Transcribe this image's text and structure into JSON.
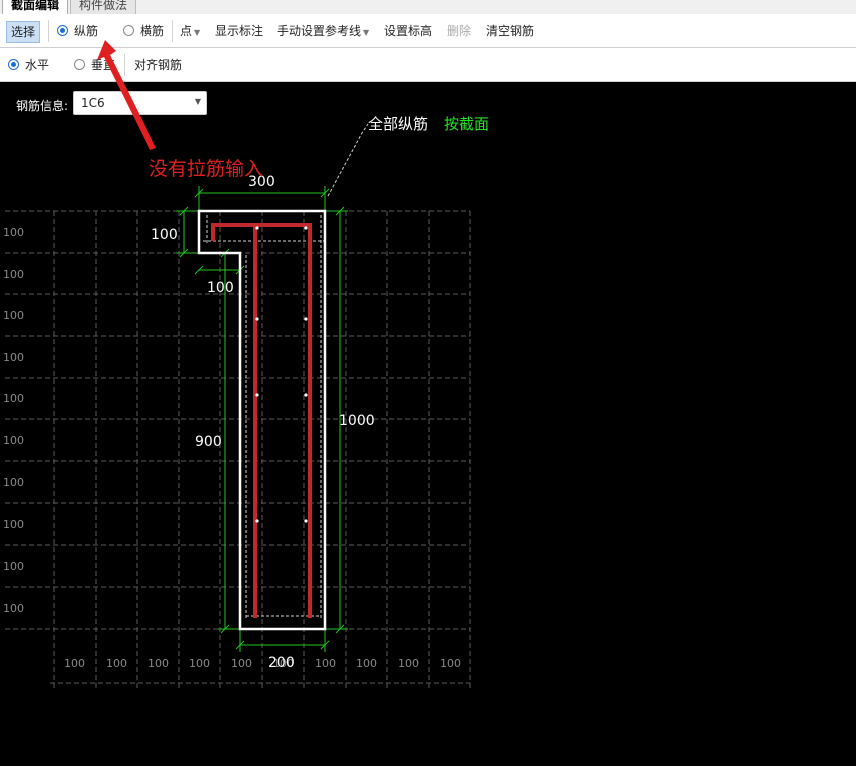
{
  "tabs": [
    "截面编辑",
    "构件做法"
  ],
  "toolbar1": {
    "select": "选择",
    "longitudinal": "纵筋",
    "transverse": "横筋",
    "point": "点",
    "show_label": "显示标注",
    "manual_ref": "手动设置参考线",
    "set_elevation": "设置标高",
    "delete": "删除",
    "clear": "清空钢筋"
  },
  "toolbar2": {
    "horizontal": "水平",
    "vertical": "垂直",
    "align": "对齐钢筋"
  },
  "rebar_info": {
    "label": "钢筋信息:",
    "value": "1C6"
  },
  "annotation": "没有拉筋输入",
  "all_longitudinal": "全部纵筋",
  "by_section": "按截面",
  "dims": {
    "top": "300",
    "flange_h": "100",
    "flange_w": "100",
    "height_full": "1000",
    "web_h": "900",
    "bottom": "200"
  },
  "grid_label": "100",
  "colors": {
    "accent": "#1a6fd1",
    "rebar": "#c0282b",
    "dim": "#22c422",
    "annotation": "#e02020"
  }
}
